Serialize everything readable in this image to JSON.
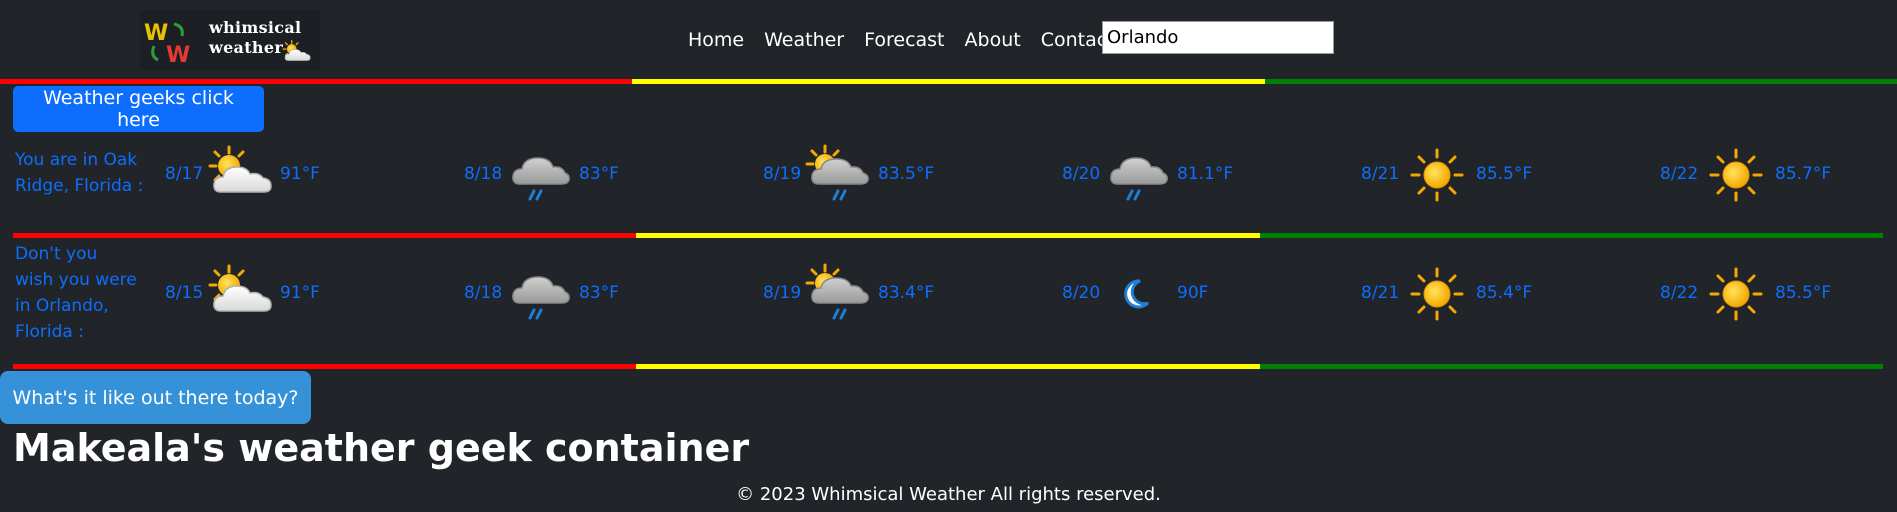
{
  "logo": {
    "line1": "whimsical",
    "line2": "weather"
  },
  "nav": [
    "Home",
    "Weather",
    "Forecast",
    "About",
    "Contact"
  ],
  "search": {
    "value": "Orlando"
  },
  "buttons": {
    "geeks": "Weather geeks click here",
    "today": "What's it like out there today?"
  },
  "rows": [
    {
      "location": "You are in Oak Ridge, Florida :",
      "days": [
        {
          "date": "8/17",
          "icon": "sun-behind-cloud-icon",
          "temp": "91°F"
        },
        {
          "date": "8/18",
          "icon": "rain-cloud-icon",
          "temp": "83°F"
        },
        {
          "date": "8/19",
          "icon": "sun-cloud-rain-icon",
          "temp": "83.5°F"
        },
        {
          "date": "8/20",
          "icon": "rain-cloud-icon",
          "temp": "81.1°F"
        },
        {
          "date": "8/21",
          "icon": "sun-icon",
          "temp": "85.5°F"
        },
        {
          "date": "8/22",
          "icon": "sun-icon",
          "temp": "85.7°F"
        }
      ]
    },
    {
      "location": "Don't you wish you were in Orlando, Florida :",
      "days": [
        {
          "date": "8/15",
          "icon": "sun-behind-cloud-icon",
          "temp": "91°F"
        },
        {
          "date": "8/18",
          "icon": "rain-cloud-icon",
          "temp": "83°F"
        },
        {
          "date": "8/19",
          "icon": "sun-cloud-rain-icon",
          "temp": "83.4°F"
        },
        {
          "date": "8/20",
          "icon": "crescent-moon-icon",
          "temp": "90F"
        },
        {
          "date": "8/21",
          "icon": "sun-icon",
          "temp": "85.4°F"
        },
        {
          "date": "8/22",
          "icon": "sun-icon",
          "temp": "85.5°F"
        }
      ]
    }
  ],
  "heading": "Makeala's weather geek container",
  "footer": "© 2023 Whimsical Weather All rights reserved.",
  "colors": {
    "background": "#212529",
    "accent": "#0d6efd",
    "bar_red": "#ff0000",
    "bar_yellow": "#ffff00",
    "bar_green": "#008000"
  }
}
